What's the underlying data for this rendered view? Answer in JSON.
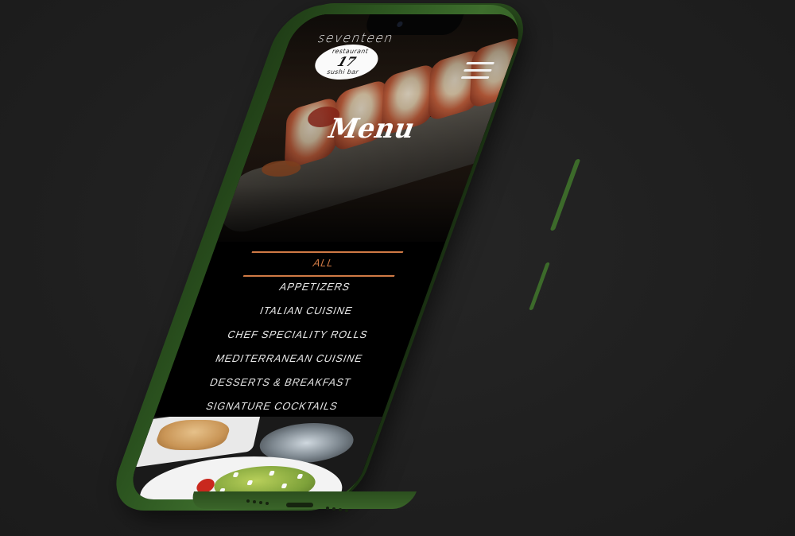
{
  "brand": {
    "wordmark": "seventeen",
    "badge_top": "restaurant",
    "badge_mark": "17",
    "badge_bottom": "sushi bar"
  },
  "hero": {
    "title": "Menu"
  },
  "menu": {
    "categories": [
      {
        "label": "ALL",
        "active": true
      },
      {
        "label": "APPETIZERS",
        "active": false
      },
      {
        "label": "ITALIAN CUISINE",
        "active": false
      },
      {
        "label": "CHEF SPECIALITY ROLLS",
        "active": false
      },
      {
        "label": "MEDITERRANEAN CUISINE",
        "active": false
      },
      {
        "label": "DESSERTS & BREAKFAST",
        "active": false
      },
      {
        "label": "SIGNATURE COCKTAILS",
        "active": false
      }
    ]
  },
  "icons": {
    "menu": "hamburger-menu-icon"
  },
  "colors": {
    "background": "#212121",
    "phone_body": "#2f5a22",
    "accent": "#d07a45",
    "text": "#e8e8e8",
    "screen_bg": "#000000"
  }
}
